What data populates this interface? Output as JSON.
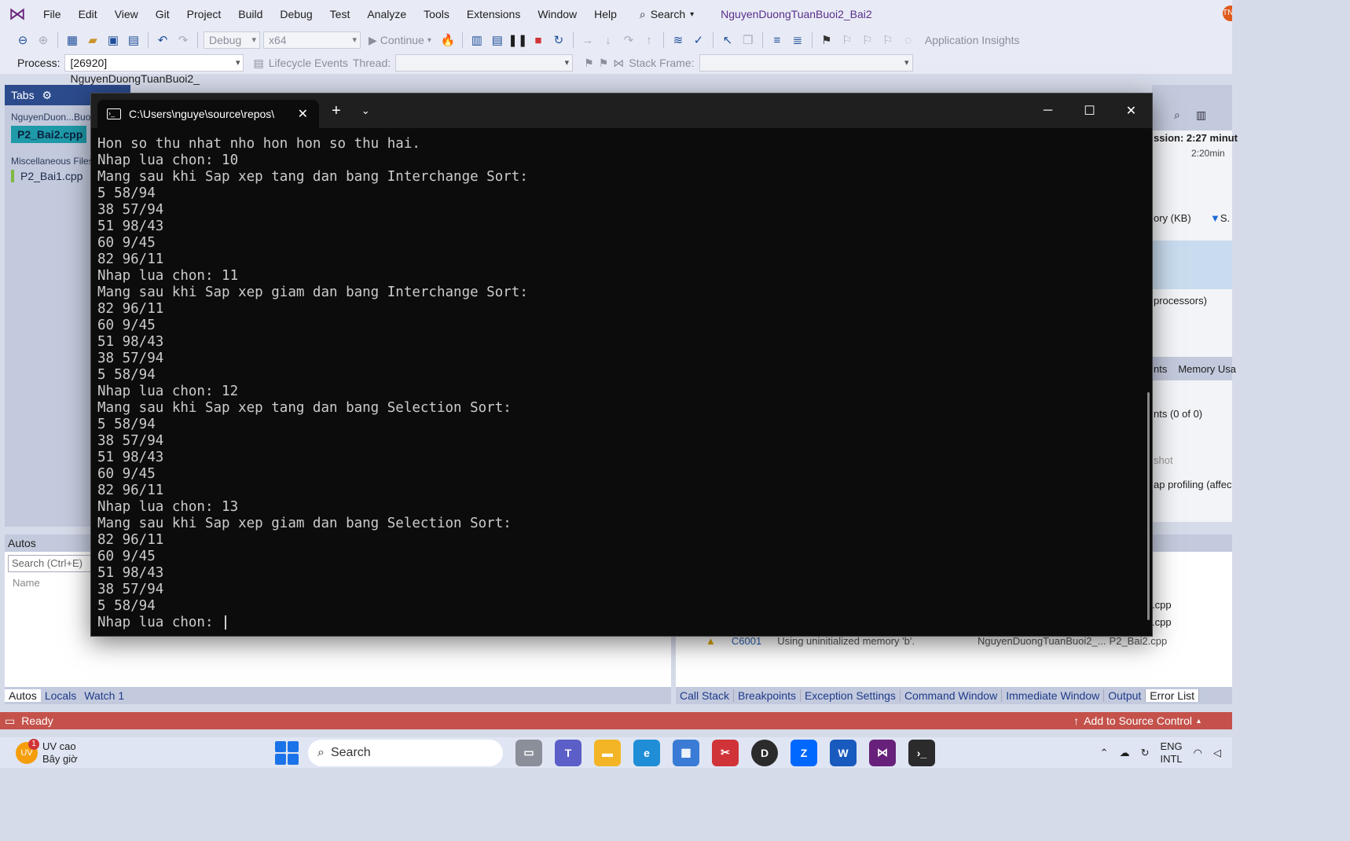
{
  "menubar": {
    "items": [
      "File",
      "Edit",
      "View",
      "Git",
      "Project",
      "Build",
      "Debug",
      "Test",
      "Analyze",
      "Tools",
      "Extensions",
      "Window",
      "Help"
    ],
    "search_label": "Search",
    "solution_title": "NguyenDuongTuanBuoi2_Bai2",
    "avatar_initials": "TN"
  },
  "toolbar": {
    "config": "Debug",
    "platform": "x64",
    "continue_label": "Continue",
    "insights_label": "Application Insights"
  },
  "debug_location": {
    "process_label": "Process:",
    "process_value": "[26920] NguyenDuongTuanBuoi2_",
    "lifecycle_label": "Lifecycle Events",
    "thread_label": "Thread:",
    "stack_frame_label": "Stack Frame:"
  },
  "tabs_panel": {
    "header": "Tabs",
    "group1": "NguyenDuon...Buoi",
    "active_tab": "P2_Bai2.cpp",
    "group2": "Miscellaneous Files",
    "other_tab": "P2_Bai1.cpp"
  },
  "diagnostics": {
    "session": "ssion: 2:27 minut",
    "time_tick": "2:20min",
    "memory": "ory (KB)",
    "s_label": "S.",
    "processors": "processors)",
    "tab_events": "nts",
    "tab_memory": "Memory Usa",
    "events_count": "nts (0 of 0)",
    "snapshot": "shot",
    "heap": "ap profiling (affec"
  },
  "autos": {
    "header": "Autos",
    "search_placeholder": "Search (Ctrl+E)",
    "col_name": "Name"
  },
  "bottom_left_tabs": [
    "Autos",
    "Locals",
    "Watch 1"
  ],
  "bottom_right_tabs": [
    "Call Stack",
    "Breakpoints",
    "Exception Settings",
    "Command Window",
    "Immediate Window",
    "Output",
    "Error List"
  ],
  "error_list": {
    "file_a": ".cpp",
    "file_b": ".cpp",
    "code": "C6001",
    "description": "Using uninitialized memory 'b'.",
    "project": "NguyenDuongTuanBuoi2_...",
    "file": "P2_Bai2.cpp"
  },
  "statusbar": {
    "text": "Ready",
    "source_control": "Add to Source Control"
  },
  "console": {
    "tab_title": "C:\\Users\\nguye\\source\\repos\\",
    "lines": [
      "Hon so thu nhat nho hon hon so thu hai.",
      "Nhap lua chon: 10",
      "Mang sau khi Sap xep tang dan bang Interchange Sort:",
      "5 58/94",
      "38 57/94",
      "51 98/43",
      "60 9/45",
      "82 96/11",
      "Nhap lua chon: 11",
      "Mang sau khi Sap xep giam dan bang Interchange Sort:",
      "82 96/11",
      "60 9/45",
      "51 98/43",
      "38 57/94",
      "5 58/94",
      "Nhap lua chon: 12",
      "Mang sau khi Sap xep tang dan bang Selection Sort:",
      "5 58/94",
      "38 57/94",
      "51 98/43",
      "60 9/45",
      "82 96/11",
      "Nhap lua chon: 13",
      "Mang sau khi Sap xep giam dan bang Selection Sort:",
      "82 96/11",
      "60 9/45",
      "51 98/43",
      "38 57/94",
      "5 58/94"
    ],
    "prompt": "Nhap lua chon: "
  },
  "taskbar": {
    "weather_title": "UV cao",
    "weather_sub": "Bây giờ",
    "weather_badge": "UV",
    "search_label": "Search",
    "lang_line1": "ENG",
    "lang_line2": "INTL"
  }
}
